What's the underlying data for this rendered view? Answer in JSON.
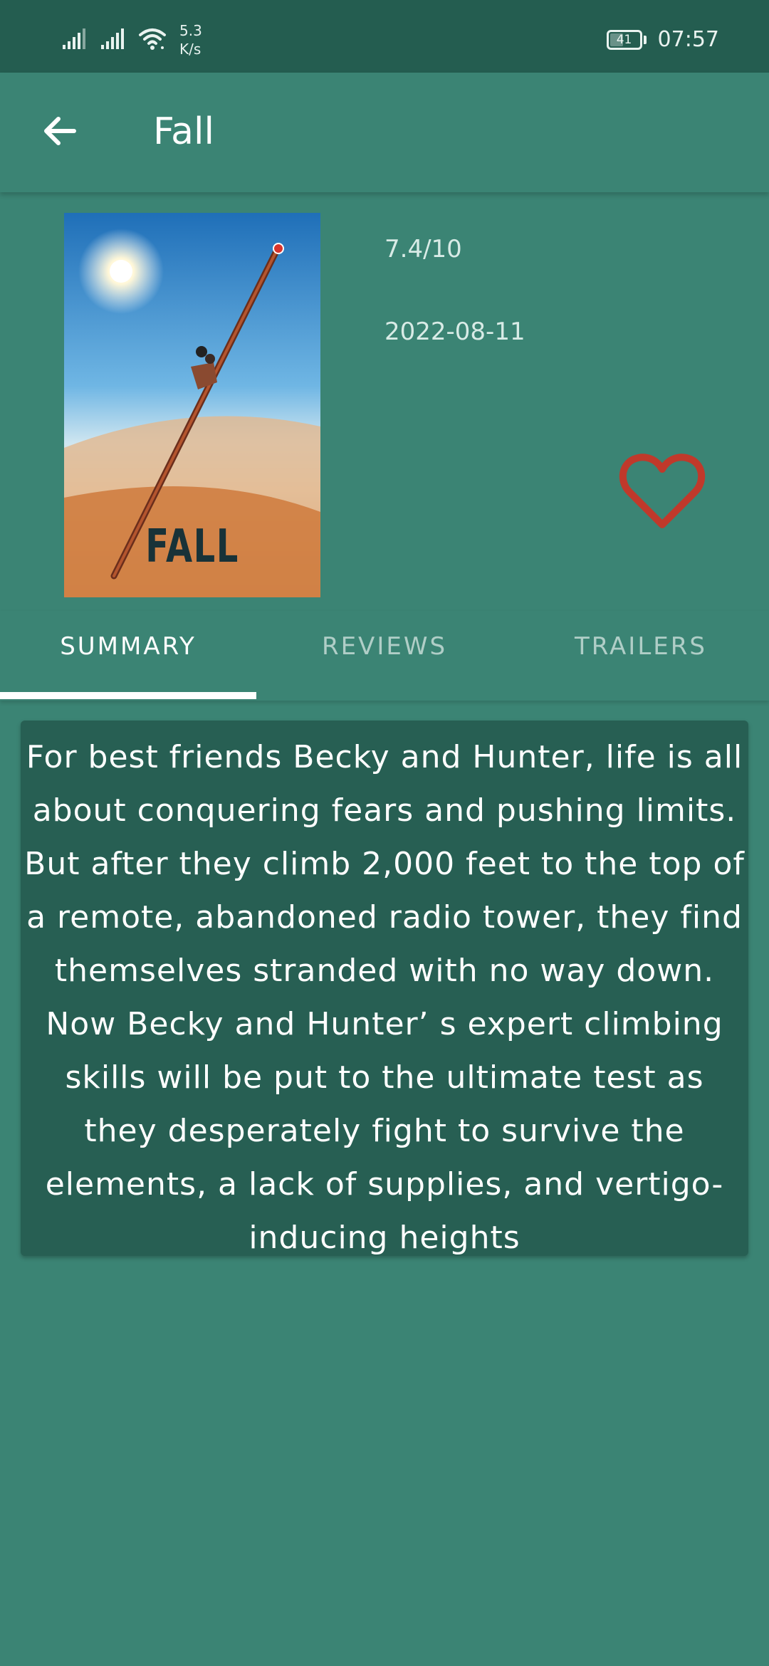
{
  "status_bar": {
    "net_speed_value": "5.3",
    "net_speed_unit": "K/s",
    "battery_level": "41",
    "time": "07:57",
    "icons": [
      "signal-icon",
      "signal-icon",
      "wifi-icon",
      "battery-icon"
    ]
  },
  "app_bar": {
    "title": "Fall",
    "back_icon": "arrow-left-icon"
  },
  "movie": {
    "poster_title": "FALL",
    "rating": "7.4/10",
    "release_date": "2022-08-11",
    "favorite_icon": "heart-outline-icon",
    "favorite_color": "#c0392b"
  },
  "tabs": [
    {
      "label": "SUMMARY",
      "active": true
    },
    {
      "label": "REVIEWS",
      "active": false
    },
    {
      "label": "TRAILERS",
      "active": false
    }
  ],
  "summary": {
    "text": "For best friends Becky and Hunter, life is all about conquering fears and pushing limits. But after they climb 2,000 feet to the top of a remote, abandoned radio tower, they find themselves stranded with no way down. Now Becky and Hunter’ s expert climbing skills will be put to the ultimate test as they desperately fight to survive the elements, a lack of supplies, and vertigo-inducing heights"
  },
  "colors": {
    "background": "#3b8474",
    "status_bar": "#245d50",
    "summary_card": "#275f53",
    "accent": "#ffffff"
  }
}
